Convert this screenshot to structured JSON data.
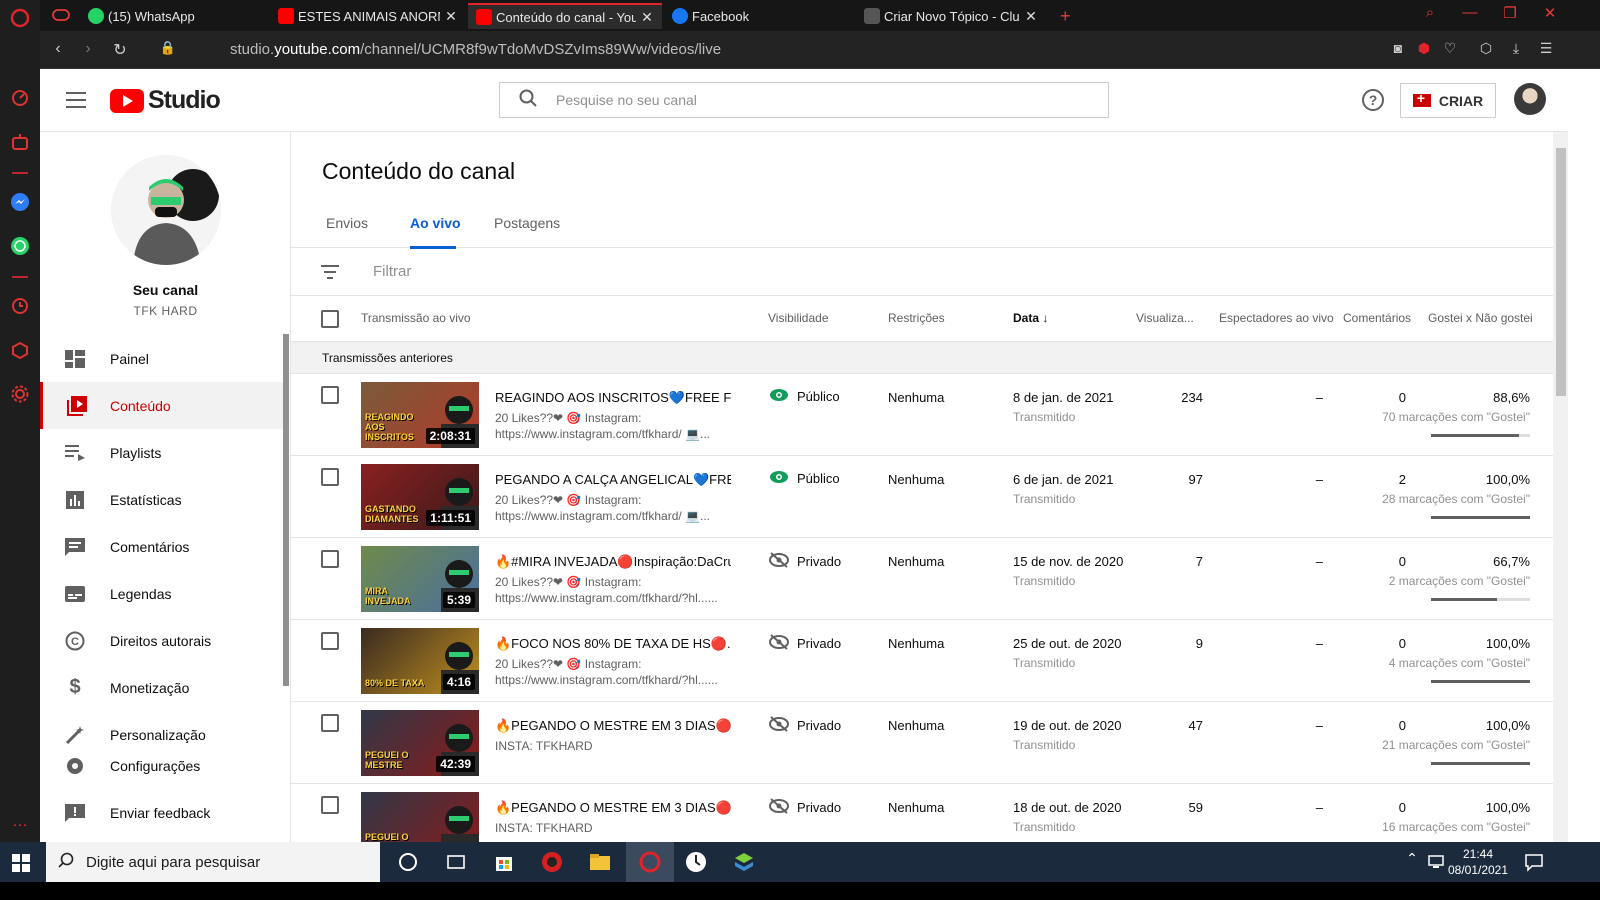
{
  "browser": {
    "tabs": [
      {
        "label": "",
        "icon": "gamepad-icon"
      },
      {
        "label": "(15) WhatsApp",
        "icon": "whatsapp-icon",
        "badge": "15"
      },
      {
        "label": "ESTES ANIMAIS ANORMAIS",
        "icon": "youtube-icon"
      },
      {
        "label": "Conteúdo do canal - YouTube",
        "icon": "youtube-icon",
        "active": true
      },
      {
        "label": "Facebook",
        "icon": "facebook-icon"
      },
      {
        "label": "Criar Novo Tópico - Clube do",
        "icon": "forum-icon"
      }
    ],
    "new_tab": "+",
    "url_prefix": "studio.",
    "url_domain": "youtube.com",
    "url_path": "/channel/UCMR8f9wTdoMvDSZvIms89Ww/videos/live"
  },
  "header": {
    "logo_text": "Studio",
    "search_placeholder": "Pesquise no seu canal",
    "help_label": "?",
    "create_label": "CRIAR"
  },
  "sidebar": {
    "channel_title": "Seu canal",
    "channel_name": "TFK HARD",
    "items": [
      {
        "label": "Painel",
        "icon": "dashboard-icon"
      },
      {
        "label": "Conteúdo",
        "icon": "content-icon",
        "active": true
      },
      {
        "label": "Playlists",
        "icon": "playlist-icon"
      },
      {
        "label": "Estatísticas",
        "icon": "analytics-icon"
      },
      {
        "label": "Comentários",
        "icon": "comments-icon"
      },
      {
        "label": "Legendas",
        "icon": "subtitles-icon"
      },
      {
        "label": "Direitos autorais",
        "icon": "copyright-icon"
      },
      {
        "label": "Monetização",
        "icon": "dollar-icon"
      },
      {
        "label": "Personalização",
        "icon": "wand-icon"
      },
      {
        "label": "Configurações",
        "icon": "gear-icon"
      },
      {
        "label": "Enviar feedback",
        "icon": "feedback-icon"
      }
    ]
  },
  "main": {
    "title": "Conteúdo do canal",
    "tabs": [
      "Envios",
      "Ao vivo",
      "Postagens"
    ],
    "active_tab": "Ao vivo",
    "filter_placeholder": "Filtrar",
    "columns": {
      "video": "Transmissão ao vivo",
      "visibility": "Visibilidade",
      "restrictions": "Restrições",
      "date": "Data",
      "views": "Visualiza...",
      "live_viewers": "Espectadores ao vivo",
      "comments": "Comentários",
      "likes": "Gostei x Não gostei"
    },
    "section_label": "Transmissões anteriores",
    "rows": [
      {
        "title": "REAGINDO AOS INSCRITOS💙FREE FIRE",
        "desc1": "20 Likes??❤ 🎯 Instagram:",
        "desc2": "https://www.instagram.com/tfkhard/ 💻...",
        "duration": "2:08:31",
        "thumb_text": "REAGINDO AOS INSCRITOS",
        "visibility": "Público",
        "vis_icon": "eye-icon",
        "restrictions": "Nenhuma",
        "date": "8 de jan. de 2021",
        "date_sub": "Transmitido",
        "views": "234",
        "live": "–",
        "comments": "0",
        "like_pct": "88,6%",
        "like_sub": "70 marcações com \"Gostei\"",
        "like_ratio": 0.886
      },
      {
        "title": "PEGANDO A CALÇA ANGELICAL💙FREE FIRE",
        "desc1": "20 Likes??❤ 🎯 Instagram:",
        "desc2": "https://www.instagram.com/tfkhard/ 💻...",
        "duration": "1:11:51",
        "thumb_text": "GASTANDO DIAMANTES",
        "visibility": "Público",
        "vis_icon": "eye-icon",
        "restrictions": "Nenhuma",
        "date": "6 de jan. de 2021",
        "date_sub": "Transmitido",
        "views": "97",
        "live": "–",
        "comments": "2",
        "like_pct": "100,0%",
        "like_sub": "28 marcações com \"Gostei\"",
        "like_ratio": 1.0
      },
      {
        "title": "🔥#MIRA INVEJADA🔴Inspiração:DaCruz",
        "desc1": "20 Likes??❤ 🎯 Instagram:",
        "desc2": "https://www.instagram.com/tfkhard/?hl......",
        "duration": "5:39",
        "thumb_text": "MIRA INVEJADA",
        "visibility": "Privado",
        "vis_icon": "eye-off-icon",
        "restrictions": "Nenhuma",
        "date": "15 de nov. de 2020",
        "date_sub": "Transmitido",
        "views": "7",
        "live": "–",
        "comments": "0",
        "like_pct": "66,7%",
        "like_sub": "2 marcações com \"Gostei\"",
        "like_ratio": 0.667
      },
      {
        "title": "🔥FOCO NOS 80% DE TAXA DE HS🔴...",
        "desc1": "20 Likes??❤ 🎯 Instagram:",
        "desc2": "https://www.instagram.com/tfkhard/?hl......",
        "duration": "4:16",
        "thumb_text": "80% DE TAXA",
        "visibility": "Privado",
        "vis_icon": "eye-off-icon",
        "restrictions": "Nenhuma",
        "date": "25 de out. de 2020",
        "date_sub": "Transmitido",
        "views": "9",
        "live": "–",
        "comments": "0",
        "like_pct": "100,0%",
        "like_sub": "4 marcações com \"Gostei\"",
        "like_ratio": 1.0
      },
      {
        "title": "🔥PEGANDO O MESTRE EM 3 DIAS🔴...",
        "desc1": "INSTA: TFKHARD",
        "desc2": "",
        "duration": "42:39",
        "thumb_text": "PEGUEI O MESTRE",
        "visibility": "Privado",
        "vis_icon": "eye-off-icon",
        "restrictions": "Nenhuma",
        "date": "19 de out. de 2020",
        "date_sub": "Transmitido",
        "views": "47",
        "live": "–",
        "comments": "0",
        "like_pct": "100,0%",
        "like_sub": "21 marcações com \"Gostei\"",
        "like_ratio": 1.0
      },
      {
        "title": "🔥PEGANDO O MESTRE EM 3 DIAS🔴...",
        "desc1": "INSTA: TFKHARD",
        "desc2": "",
        "duration": "",
        "thumb_text": "PEGUEI O MESTRE",
        "visibility": "Privado",
        "vis_icon": "eye-off-icon",
        "restrictions": "Nenhuma",
        "date": "18 de out. de 2020",
        "date_sub": "Transmitido",
        "views": "59",
        "live": "–",
        "comments": "0",
        "like_pct": "100,0%",
        "like_sub": "16 marcações com \"Gostei\"",
        "like_ratio": 1.0
      }
    ]
  },
  "taskbar": {
    "search_placeholder": "Digite aqui para pesquisar",
    "time": "21:44",
    "date": "08/01/2021"
  },
  "colors": {
    "accent_red": "#cc0000",
    "link_blue": "#065fd4",
    "public_green": "#0f9d58"
  }
}
